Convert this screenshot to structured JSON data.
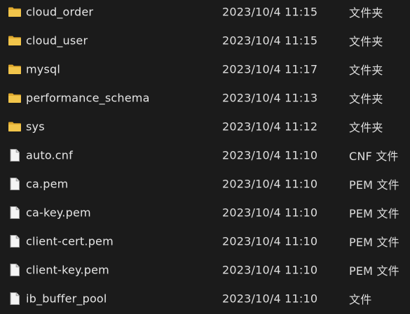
{
  "colors": {
    "background": "#1b1b1b",
    "text": "#e6e6e6",
    "folder": "#f2c54b",
    "file": "#f4f4f4"
  },
  "files": [
    {
      "name": "cloud_order",
      "modified": "2023/10/4 11:15",
      "type": "文件夹",
      "icon": "folder-icon"
    },
    {
      "name": "cloud_user",
      "modified": "2023/10/4 11:15",
      "type": "文件夹",
      "icon": "folder-icon"
    },
    {
      "name": "mysql",
      "modified": "2023/10/4 11:17",
      "type": "文件夹",
      "icon": "folder-icon"
    },
    {
      "name": "performance_schema",
      "modified": "2023/10/4 11:13",
      "type": "文件夹",
      "icon": "folder-icon"
    },
    {
      "name": "sys",
      "modified": "2023/10/4 11:12",
      "type": "文件夹",
      "icon": "folder-icon"
    },
    {
      "name": "auto.cnf",
      "modified": "2023/10/4 11:10",
      "type": "CNF 文件",
      "icon": "file-icon"
    },
    {
      "name": "ca.pem",
      "modified": "2023/10/4 11:10",
      "type": "PEM 文件",
      "icon": "file-icon"
    },
    {
      "name": "ca-key.pem",
      "modified": "2023/10/4 11:10",
      "type": "PEM 文件",
      "icon": "file-icon"
    },
    {
      "name": "client-cert.pem",
      "modified": "2023/10/4 11:10",
      "type": "PEM 文件",
      "icon": "file-icon"
    },
    {
      "name": "client-key.pem",
      "modified": "2023/10/4 11:10",
      "type": "PEM 文件",
      "icon": "file-icon"
    },
    {
      "name": "ib_buffer_pool",
      "modified": "2023/10/4 11:10",
      "type": "文件",
      "icon": "file-icon"
    }
  ]
}
